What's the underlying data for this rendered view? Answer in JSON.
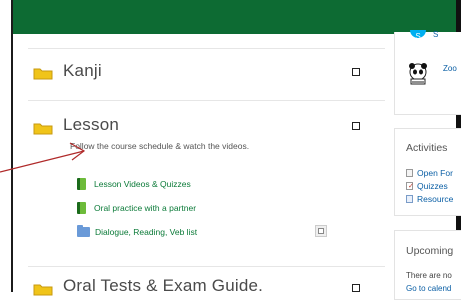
{
  "sections": [
    {
      "title": "Kanji"
    },
    {
      "title": "Lesson",
      "summary": "Follow the course schedule & watch the videos.",
      "activities": [
        {
          "label": "Lesson Videos & Quizzes",
          "icon": "book-icon"
        },
        {
          "label": "Oral practice with a partner",
          "icon": "book-icon"
        },
        {
          "label": "Dialogue, Reading, Veb list",
          "icon": "folder-icon"
        }
      ]
    },
    {
      "title": "Oral Tests & Exam Guide."
    }
  ],
  "sidebar": {
    "apps": [
      {
        "label": "S",
        "icon": "skype-icon"
      },
      {
        "label": "Zoo",
        "icon": "panda-icon"
      }
    ],
    "activities_block": {
      "title": "Activities",
      "items": [
        {
          "label": "Open For",
          "icon": "forum-icon"
        },
        {
          "label": "Quizzes",
          "icon": "quiz-icon"
        },
        {
          "label": "Resource",
          "icon": "file-icon"
        }
      ]
    },
    "upcoming_block": {
      "title": "Upcoming",
      "text": "There are no",
      "link": "Go to calend"
    }
  },
  "colors": {
    "topbar": "#0d6b33",
    "link_green": "#0b7a38",
    "link_blue": "#0b5fa5",
    "arrow": "#b02a2a"
  }
}
